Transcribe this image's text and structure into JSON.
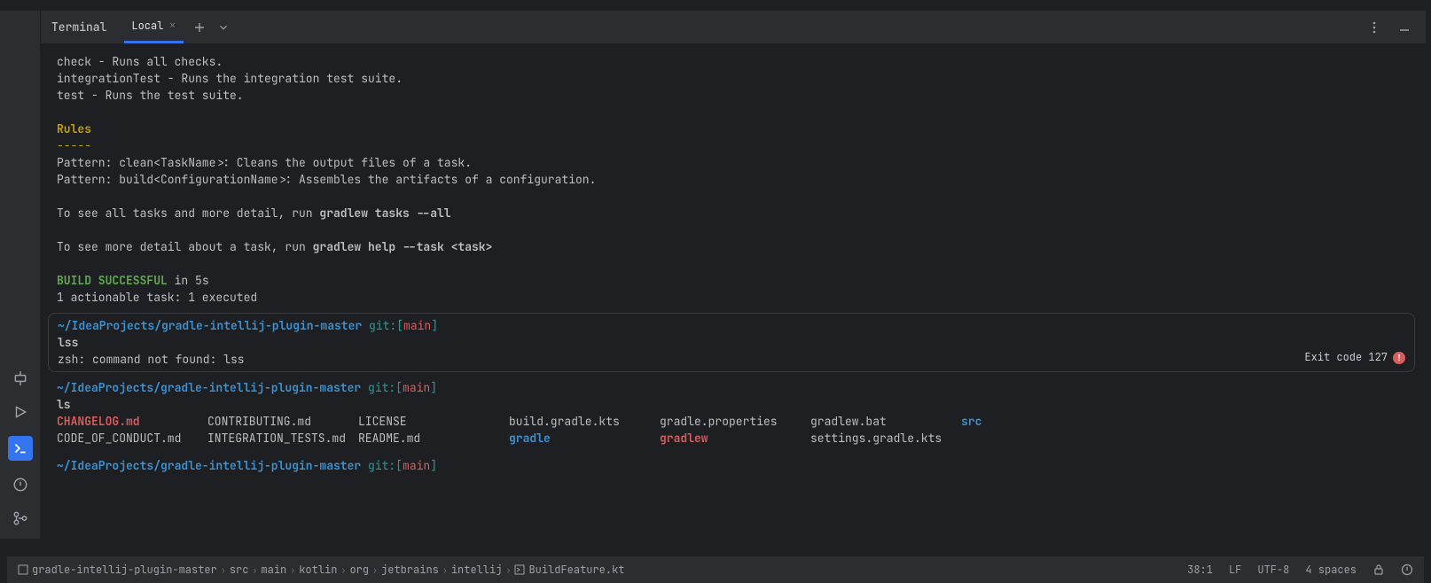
{
  "tabs": {
    "tool_title": "Terminal",
    "active_tab": "Local"
  },
  "output1": {
    "l1": "check - Runs all checks.",
    "l2": "integrationTest - Runs the integration test suite.",
    "l3": "test - Runs the test suite.",
    "rules_title": "Rules",
    "rules_dash": "-----",
    "p1": "Pattern: clean<TaskName>: Cleans the output files of a task.",
    "p2": "Pattern: build<ConfigurationName>: Assembles the artifacts of a configuration.",
    "see1_pre": "To see all tasks and more detail, run ",
    "see1_cmd": "gradlew tasks --all",
    "see2_pre": "To see more detail about a task, run ",
    "see2_cmd": "gradlew help --task <task>",
    "build_success": "BUILD SUCCESSFUL",
    "build_in": " in 5s",
    "actionable": "1 actionable task: 1 executed"
  },
  "block_err": {
    "prompt_path": "~/IdeaProjects/gradle-intellij-plugin-master",
    "prompt_git": "git:",
    "prompt_branch_open": "[",
    "prompt_branch": "main",
    "prompt_branch_close": "]",
    "cmd": "lss",
    "err_msg": "zsh: command not found: lss",
    "exit_label": "Exit code 127"
  },
  "block_ls": {
    "prompt_path": "~/IdeaProjects/gradle-intellij-plugin-master",
    "prompt_git": "git:",
    "prompt_branch": "main",
    "cmd": "ls",
    "files": {
      "r1c1": "CHANGELOG.md",
      "r1c2": "CONTRIBUTING.md",
      "r1c3": "LICENSE",
      "r1c4": "build.gradle.kts",
      "r1c5": "gradle.properties",
      "r1c6": "gradlew.bat",
      "r1c7": "src",
      "r2c1": "CODE_OF_CONDUCT.md",
      "r2c2": "INTEGRATION_TESTS.md",
      "r2c3": "README.md",
      "r2c4": "gradle",
      "r2c5": "gradlew",
      "r2c6": "settings.gradle.kts"
    }
  },
  "block_last": {
    "prompt_path": "~/IdeaProjects/gradle-intellij-plugin-master",
    "prompt_git": "git:",
    "prompt_branch": "main"
  },
  "breadcrumb": {
    "b1": "gradle-intellij-plugin-master",
    "b2": "src",
    "b3": "main",
    "b4": "kotlin",
    "b5": "org",
    "b6": "jetbrains",
    "b7": "intellij",
    "b8": "BuildFeature.kt"
  },
  "status": {
    "pos": "38:1",
    "line_sep": "LF",
    "encoding": "UTF-8",
    "indent": "4 spaces"
  }
}
